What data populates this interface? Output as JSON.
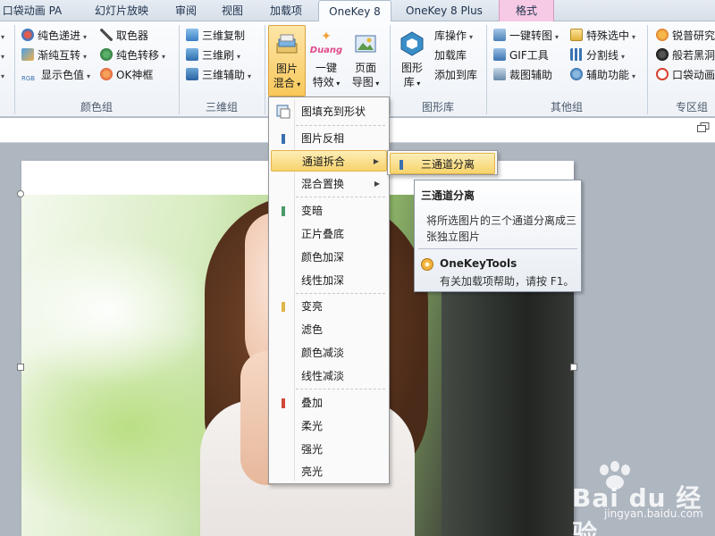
{
  "tabs": [
    "口袋动画 PA",
    "幻灯片放映",
    "审阅",
    "视图",
    "加载项",
    "OneKey 8",
    "OneKey 8 Plus",
    "格式"
  ],
  "ribbon": {
    "color_group": {
      "items": [
        "纯色递进",
        "渐纯互转",
        "显示色值",
        "取色器",
        "纯色转移",
        "OK神框"
      ],
      "label": "颜色组",
      "rgb_tag": "RGB"
    },
    "threed_group": {
      "items": [
        "三维复制",
        "三维刷",
        "三维辅助"
      ],
      "label": "三维组"
    },
    "big_buttons": {
      "picture_mix": [
        "图片",
        "混合"
      ],
      "oneclick_effect": [
        "一键",
        "特效"
      ],
      "page_to_image": [
        "页面",
        "导图"
      ],
      "duang": "Duang"
    },
    "graphics_group": {
      "big": [
        "图形",
        "库"
      ],
      "items": [
        "库操作",
        "加载库",
        "添加到库"
      ],
      "label": "图形库"
    },
    "other_group": {
      "items": [
        "一键转图",
        "GIF工具",
        "裁图辅助",
        "特殊选中",
        "分割线",
        "辅助功能"
      ],
      "label": "其他组"
    },
    "special_group": {
      "items": [
        "锐普研究",
        "般若黑洞",
        "口袋动画"
      ],
      "label": "专区组"
    }
  },
  "menu": {
    "items": [
      "图填充到形状",
      "图片反相",
      "通道拆合",
      "混合置换",
      "变暗",
      "正片叠底",
      "颜色加深",
      "线性加深",
      "变亮",
      "滤色",
      "颜色减淡",
      "线性减淡",
      "叠加",
      "柔光",
      "强光",
      "亮光"
    ],
    "highlighted": "通道拆合"
  },
  "submenu": {
    "item": "三通道分离"
  },
  "tooltip": {
    "title": "三通道分离",
    "description": "将所选图片的三个通道分离成三张独立图片",
    "brand": "OneKeyTools",
    "help": "有关加载项帮助，请按 F1。"
  },
  "watermark": {
    "text": "Bai du 经验",
    "sub": "jingyan.baidu.com"
  },
  "colors": {
    "accent": "#f7d36b",
    "tab_format": "#f6c9e4",
    "bar_blue": "#3a6fb0",
    "bar_green": "#4a9a6a",
    "bar_yellow": "#e0b64a",
    "bar_red": "#d0483a"
  }
}
